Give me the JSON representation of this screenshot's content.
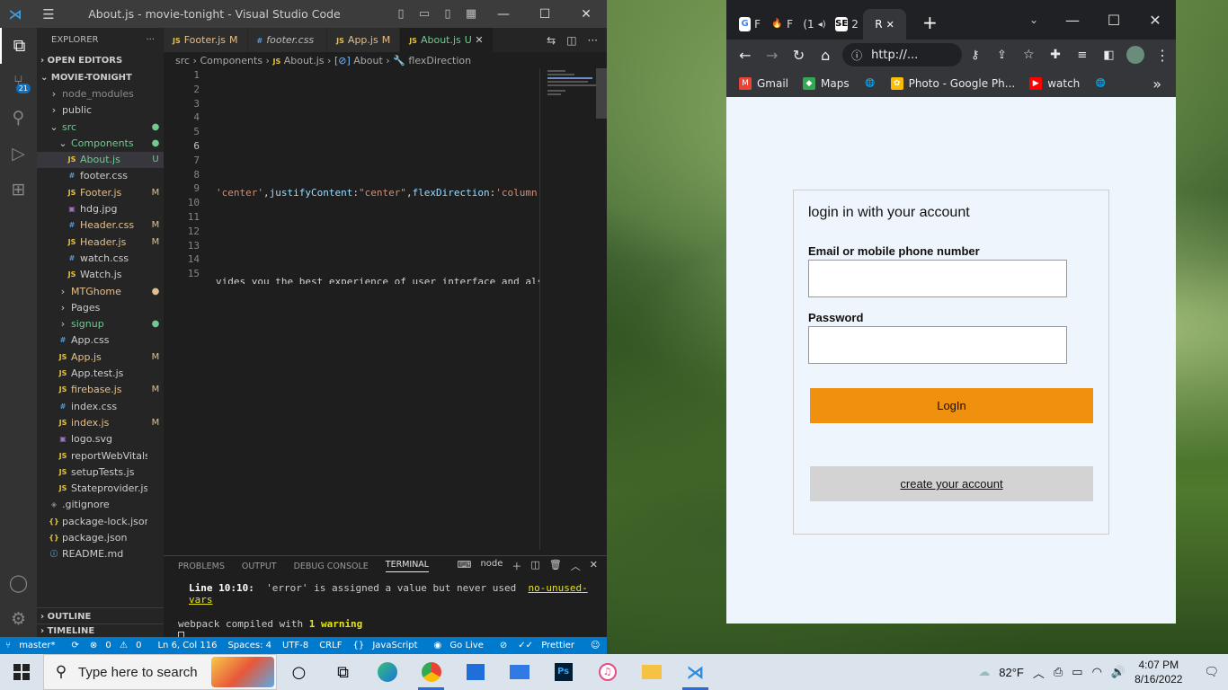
{
  "vscode": {
    "title": "About.js - movie-tonight - Visual Studio Code",
    "explorer_label": "EXPLORER",
    "open_editors": "OPEN EDITORS",
    "project": "MOVIE-TONIGHT",
    "outline": "OUTLINE",
    "timeline": "TIMELINE",
    "tree": [
      {
        "name": "node_modules",
        "type": "folder",
        "depth": 1,
        "status": "",
        "cls": "dim"
      },
      {
        "name": "public",
        "type": "folder",
        "depth": 1,
        "status": "",
        "cls": ""
      },
      {
        "name": "src",
        "type": "folder-open",
        "depth": 1,
        "status": "●",
        "cls": "new"
      },
      {
        "name": "Components",
        "type": "folder-open",
        "depth": 2,
        "status": "●",
        "cls": "new"
      },
      {
        "name": "About.js",
        "type": "js",
        "depth": 3,
        "status": "U",
        "cls": "unt",
        "selected": true
      },
      {
        "name": "footer.css",
        "type": "css",
        "depth": 3,
        "status": "",
        "cls": ""
      },
      {
        "name": "Footer.js",
        "type": "js",
        "depth": 3,
        "status": "M",
        "cls": "mod"
      },
      {
        "name": "hdg.jpg",
        "type": "img",
        "depth": 3,
        "status": "",
        "cls": ""
      },
      {
        "name": "Header.css",
        "type": "css",
        "depth": 3,
        "status": "M",
        "cls": "mod"
      },
      {
        "name": "Header.js",
        "type": "js",
        "depth": 3,
        "status": "M",
        "cls": "mod"
      },
      {
        "name": "watch.css",
        "type": "css",
        "depth": 3,
        "status": "",
        "cls": ""
      },
      {
        "name": "Watch.js",
        "type": "js",
        "depth": 3,
        "status": "",
        "cls": ""
      },
      {
        "name": "MTGhome",
        "type": "folder",
        "depth": 2,
        "status": "●",
        "cls": "mod"
      },
      {
        "name": "Pages",
        "type": "folder",
        "depth": 2,
        "status": "",
        "cls": ""
      },
      {
        "name": "signup",
        "type": "folder",
        "depth": 2,
        "status": "●",
        "cls": "new"
      },
      {
        "name": "App.css",
        "type": "css",
        "depth": 2,
        "status": "",
        "cls": ""
      },
      {
        "name": "App.js",
        "type": "js",
        "depth": 2,
        "status": "M",
        "cls": "mod"
      },
      {
        "name": "App.test.js",
        "type": "js",
        "depth": 2,
        "status": "",
        "cls": ""
      },
      {
        "name": "firebase.js",
        "type": "js",
        "depth": 2,
        "status": "M",
        "cls": "mod"
      },
      {
        "name": "index.css",
        "type": "css",
        "depth": 2,
        "status": "",
        "cls": ""
      },
      {
        "name": "index.js",
        "type": "js",
        "depth": 2,
        "status": "M",
        "cls": "mod"
      },
      {
        "name": "logo.svg",
        "type": "img",
        "depth": 2,
        "status": "",
        "cls": ""
      },
      {
        "name": "reportWebVitals.js",
        "type": "js",
        "depth": 2,
        "status": "",
        "cls": ""
      },
      {
        "name": "setupTests.js",
        "type": "js",
        "depth": 2,
        "status": "",
        "cls": ""
      },
      {
        "name": "Stateprovider.js",
        "type": "js",
        "depth": 2,
        "status": "",
        "cls": ""
      },
      {
        "name": ".gitignore",
        "type": "gi",
        "depth": 1,
        "status": "",
        "cls": ""
      },
      {
        "name": "package-lock.json",
        "type": "json",
        "depth": 1,
        "status": "",
        "cls": ""
      },
      {
        "name": "package.json",
        "type": "json",
        "depth": 1,
        "status": "",
        "cls": ""
      },
      {
        "name": "README.md",
        "type": "md",
        "depth": 1,
        "status": "",
        "cls": ""
      }
    ],
    "tabs": [
      {
        "name": "Footer.js",
        "icon": "JS",
        "status": "M",
        "active": false,
        "italic": false
      },
      {
        "name": "footer.css",
        "icon": "#",
        "status": "",
        "active": false,
        "italic": true
      },
      {
        "name": "App.js",
        "icon": "JS",
        "status": "M",
        "active": false,
        "italic": false
      },
      {
        "name": "About.js",
        "icon": "JS",
        "status": "U",
        "active": true,
        "italic": false
      }
    ],
    "breadcrumb": [
      "src",
      "Components",
      "About.js",
      "About",
      "flexDirection"
    ],
    "line_numbers": [
      "1",
      "2",
      "3",
      "4",
      "5",
      "6",
      "7",
      "8",
      "9",
      "10",
      "11",
      "12",
      "13",
      "14",
      "15"
    ],
    "code_line6_a": "'center'",
    "code_line6_b": ",",
    "code_line6_c": "justifyContent",
    "code_line6_d": ":",
    "code_line6_e": "\"center\"",
    "code_line6_f": ",",
    "code_line6_g": "flexDirection",
    "code_line6_h": ":",
    "code_line6_i": "'column'",
    "code_line6_j": "}",
    "code_line9": "vides you the best experience of user interface and also",
    "panel_tabs": [
      "PROBLEMS",
      "OUTPUT",
      "DEBUG CONSOLE",
      "TERMINAL"
    ],
    "panel_shell": "node",
    "term_line1_loc": "Line 10:10:",
    "term_line1_msg": "  'error' is assigned a value but never used  ",
    "term_line1_rule": "no-unused-vars",
    "term_line2_a": "webpack compiled with ",
    "term_line2_b": "1 warning",
    "status": {
      "branch": "master*",
      "errors": "0",
      "warnings": "0",
      "position": "Ln 6, Col 116",
      "spaces": "Spaces: 4",
      "encoding": "UTF-8",
      "eol": "CRLF",
      "language": "JavaScript",
      "golive": "Go Live",
      "prettier": "Prettier"
    },
    "scm_badge": "21"
  },
  "chrome": {
    "tabs": [
      {
        "label": "F",
        "fav": "G",
        "color": "#fff",
        "bg": "#fff",
        "fg": "#4285f4"
      },
      {
        "label": "F",
        "fav": "🔥",
        "color": "#fff",
        "bg": "transparent",
        "fg": "#ffa000"
      },
      {
        "label": "(1",
        "fav": "",
        "color": "#fff",
        "bg": "transparent",
        "fg": "#fff"
      },
      {
        "label": "2",
        "fav": "SE",
        "color": "#fff",
        "bg": "#fff",
        "fg": "#000"
      },
      {
        "label": "R",
        "fav": "",
        "color": "#fff",
        "bg": "transparent",
        "fg": "#fff",
        "active": true
      }
    ],
    "url": "http://...",
    "bookmarks": [
      {
        "label": "Gmail",
        "icon": "M",
        "bg": "#ea4335"
      },
      {
        "label": "Maps",
        "icon": "◆",
        "bg": "#34a853"
      },
      {
        "label": "",
        "icon": "🌐",
        "bg": "transparent"
      },
      {
        "label": "Photo - Google Ph...",
        "icon": "✿",
        "bg": "#fbbc05"
      },
      {
        "label": "watch",
        "icon": "▶",
        "bg": "#ff0000"
      },
      {
        "label": "",
        "icon": "🌐",
        "bg": "transparent"
      }
    ],
    "form": {
      "heading": "login in with your account",
      "email_label": "Email or mobile phone number",
      "email_value": "",
      "password_label": "Password",
      "password_value": "",
      "login_button": "LogIn",
      "create_button": "create your account"
    }
  },
  "taskbar": {
    "search_placeholder": "Type here to search",
    "weather": "82°F",
    "time": "4:07 PM",
    "date": "8/16/2022"
  }
}
